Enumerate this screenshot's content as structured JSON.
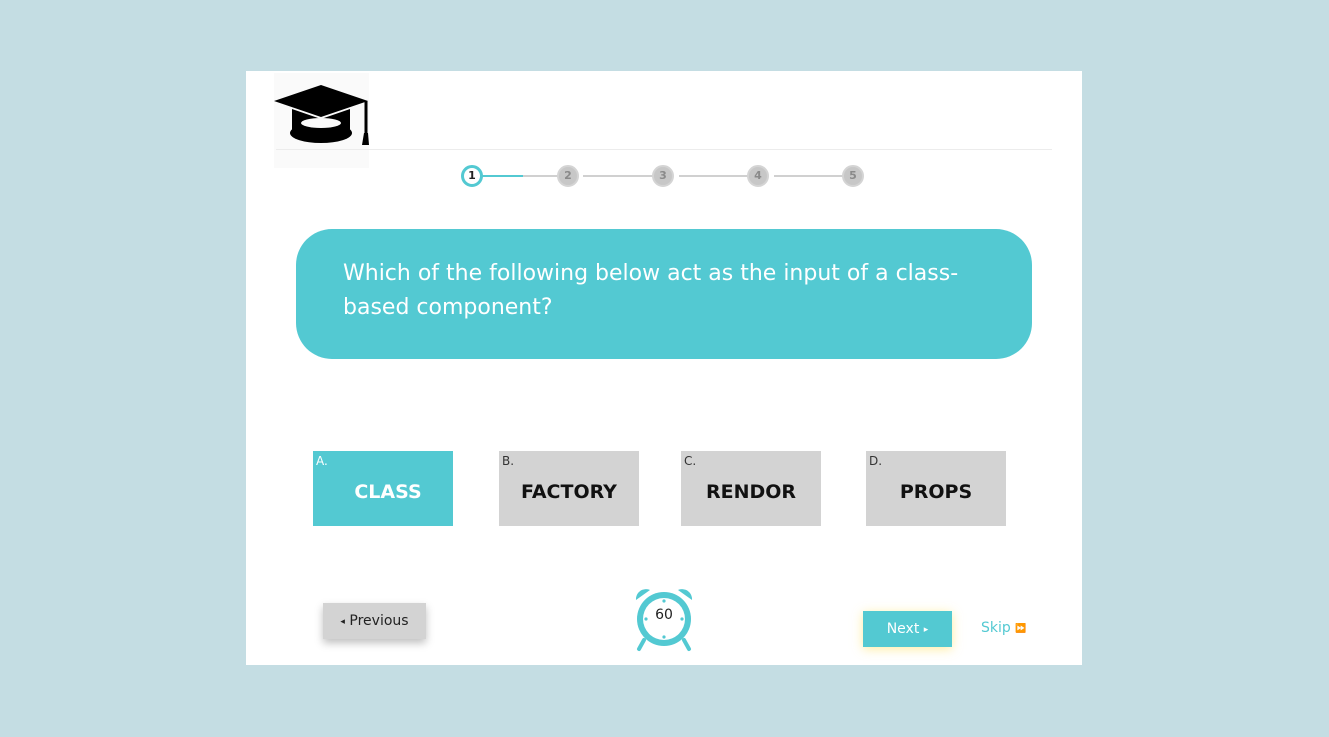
{
  "logo": {
    "icon": "graduation-cap-icon"
  },
  "stepper": {
    "current": 1,
    "steps": [
      "1",
      "2",
      "3",
      "4",
      "5"
    ]
  },
  "question": {
    "text": "Which of the following below act as the input of a class-based component?"
  },
  "options": [
    {
      "letter": "A.",
      "label": "CLASS",
      "selected": true
    },
    {
      "letter": "B.",
      "label": "FACTORY",
      "selected": false
    },
    {
      "letter": "C.",
      "label": "RENDOR",
      "selected": false
    },
    {
      "letter": "D.",
      "label": "PROPS",
      "selected": false
    }
  ],
  "navigation": {
    "previous_arrow": "◂",
    "previous_label": "Previous",
    "next_label": "Next",
    "next_arrow": "▸",
    "skip_label": "Skip",
    "skip_arrow": "⏩"
  },
  "timer": {
    "icon": "alarm-clock-icon",
    "value": "60"
  },
  "colors": {
    "accent": "#53c9d2",
    "background": "#c4dde3",
    "option_default": "#d3d3d3"
  }
}
